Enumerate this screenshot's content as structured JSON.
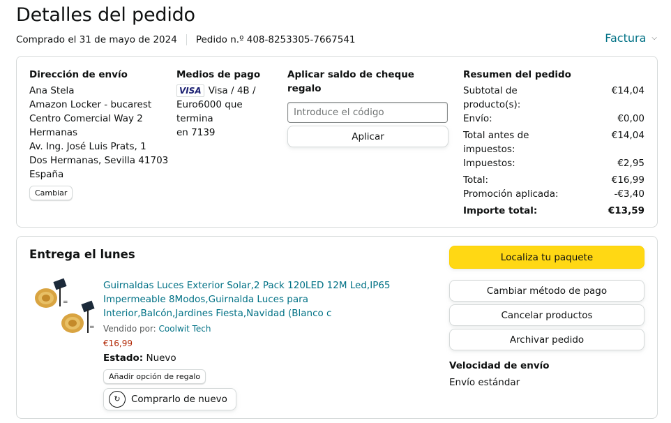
{
  "page": {
    "title": "Detalles del pedido",
    "purchase_date": "Comprado el 31 de mayo de 2024",
    "order_number": "Pedido n.º 408-8253305-7667541",
    "invoice_label": "Factura"
  },
  "shipping": {
    "heading": "Dirección de envío",
    "lines": [
      "Ana Stela",
      "Amazon Locker - bucarest",
      "Centro Comercial Way 2",
      "Hermanas",
      "Av. Ing. José Luis Prats, 1",
      "Dos Hermanas, Sevilla 41703",
      "España"
    ],
    "change_label": "Cambiar"
  },
  "payment": {
    "heading": "Medios de pago",
    "card_brand": "VISA",
    "lines": [
      "Visa / 4B /",
      "Euro6000 que termina",
      "en 7139"
    ]
  },
  "gift": {
    "heading": "Aplicar saldo de cheque regalo",
    "placeholder": "Introduce el código",
    "apply_label": "Aplicar"
  },
  "summary": {
    "heading": "Resumen del pedido",
    "rows": [
      {
        "label": "Subtotal de producto(s):",
        "value": "€14,04"
      },
      {
        "label": "Envío:",
        "value": "€0,00"
      },
      {
        "label": "Total antes de impuestos:",
        "value": "€14,04"
      },
      {
        "label": "Impuestos:",
        "value": "€2,95"
      },
      {
        "label": "Total:",
        "value": "€16,99"
      },
      {
        "label": "Promoción aplicada:",
        "value": "-€3,40"
      }
    ],
    "grand_total_label": "Importe total:",
    "grand_total_value": "€13,59"
  },
  "delivery": {
    "title": "Entrega el lunes",
    "product": {
      "title": "Guirnaldas Luces Exterior Solar,2 Pack 120LED 12M Led,IP65 Impermeable 8Modos,Guirnalda Luces para Interior,Balcón,Jardines Fiesta,Navidad (Blanco c",
      "seller_prefix": "Vendido por:",
      "seller": "Coolwit Tech",
      "price": "€16,99",
      "condition_label": "Estado:",
      "condition_value": "Nuevo",
      "gift_option_label": "Añadir opción de regalo",
      "buy_again_label": "Comprarlo de nuevo"
    },
    "actions": {
      "track": "Localiza tu paquete",
      "change_payment": "Cambiar método de pago",
      "cancel": "Cancelar productos",
      "archive": "Archivar pedido"
    },
    "shipping_speed_heading": "Velocidad de envío",
    "shipping_speed_value": "Envío estándar"
  },
  "colors": {
    "link": "#007185",
    "price": "#b12704",
    "primary_button": "#ffd814",
    "border": "#d5d9d9"
  }
}
